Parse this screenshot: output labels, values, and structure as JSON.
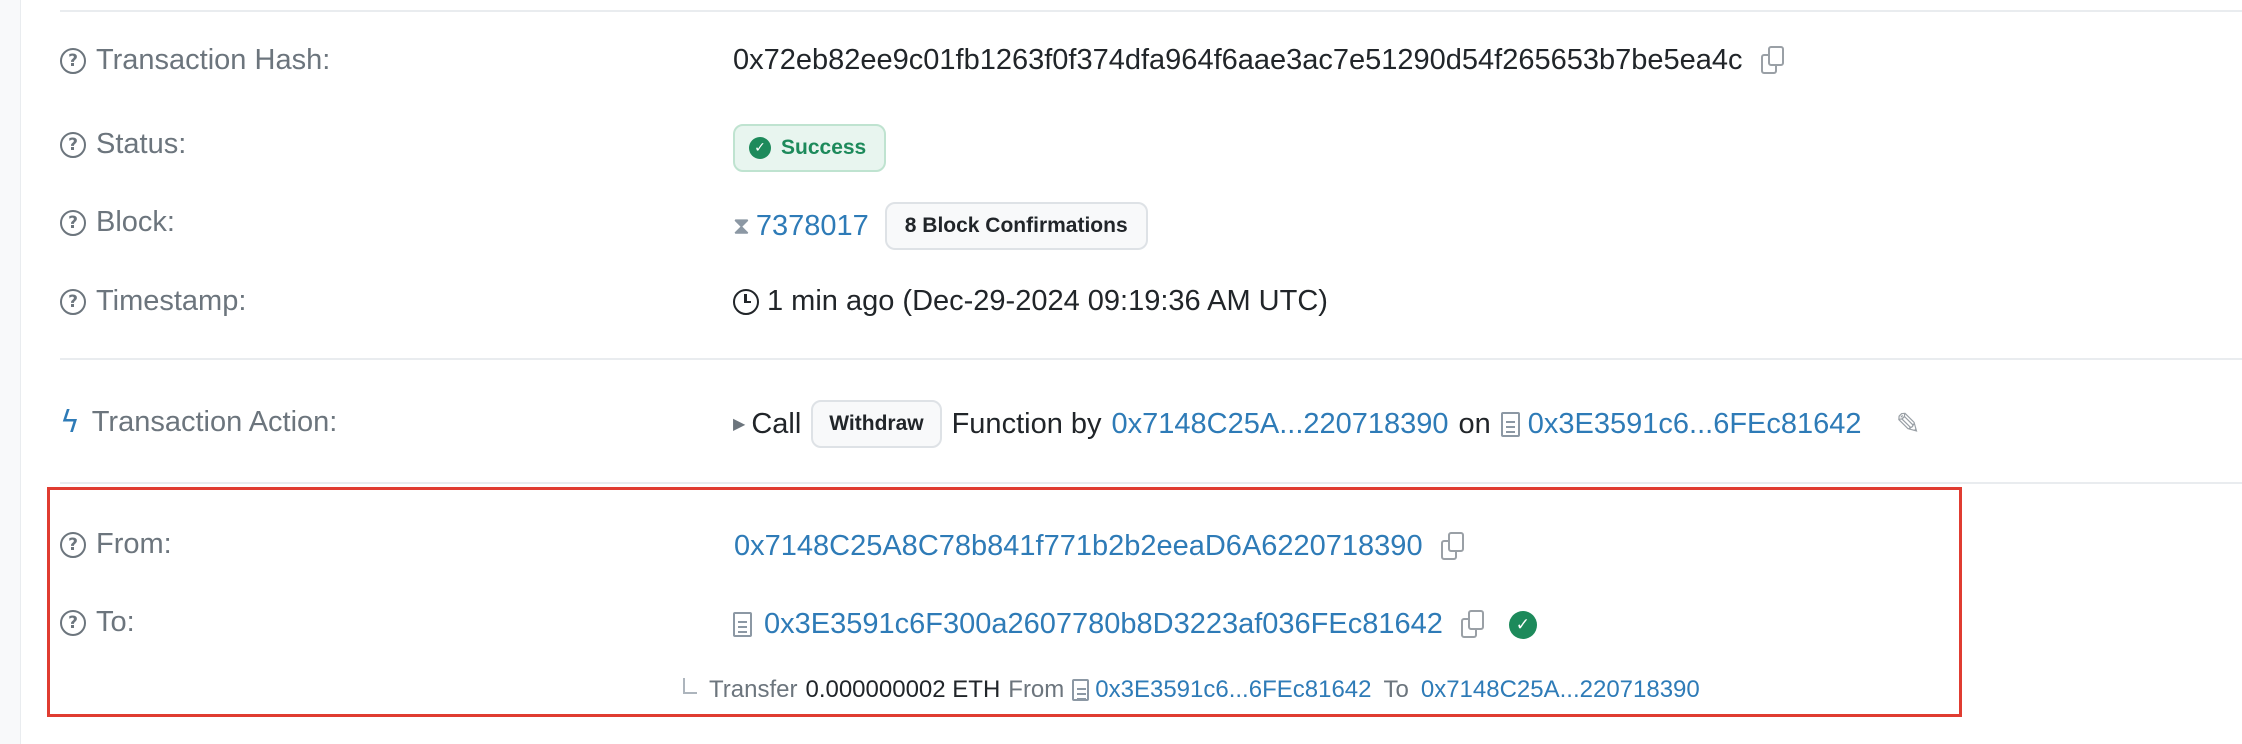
{
  "details": {
    "tx_hash": {
      "label": "Transaction Hash:",
      "value": "0x72eb82ee9c01fb1263f0f374dfa964f6aae3ac7e51290d54f265653b7be5ea4c"
    },
    "status": {
      "label": "Status:",
      "value": "Success"
    },
    "block": {
      "label": "Block:",
      "number": "7378017",
      "confirmations": "8 Block Confirmations"
    },
    "timestamp": {
      "label": "Timestamp:",
      "value": "1 min ago (Dec-29-2024 09:19:36 AM UTC)"
    },
    "action": {
      "label": "Transaction Action:",
      "call": "Call",
      "function_name": "Withdraw",
      "function_by": "Function by",
      "caller": "0x7148C25A...220718390",
      "on": "on",
      "contract": "0x3E3591c6...6FEc81642"
    },
    "from": {
      "label": "From:",
      "address": "0x7148C25A8C78b841f771b2b2eeaD6A6220718390"
    },
    "to": {
      "label": "To:",
      "address": "0x3E3591c6F300a2607780b8D3223af036FEc81642"
    },
    "transfer": {
      "prefix": "Transfer",
      "amount": "0.000000002 ETH",
      "from_label": "From",
      "from_address": "0x3E3591c6...6FEc81642",
      "to_label": "To",
      "to_address": "0x7148C25A...220718390"
    }
  },
  "colors": {
    "link": "#2e7bb7",
    "success": "#1d8a5b",
    "highlight": "#e03c31",
    "label": "#6c757d"
  },
  "icons": [
    "question-circle-icon",
    "copy-icon",
    "check-circle-icon",
    "hourglass-icon",
    "clock-icon",
    "lightning-icon",
    "caret-right-icon",
    "contract-doc-icon",
    "pencil-icon",
    "verified-icon"
  ]
}
